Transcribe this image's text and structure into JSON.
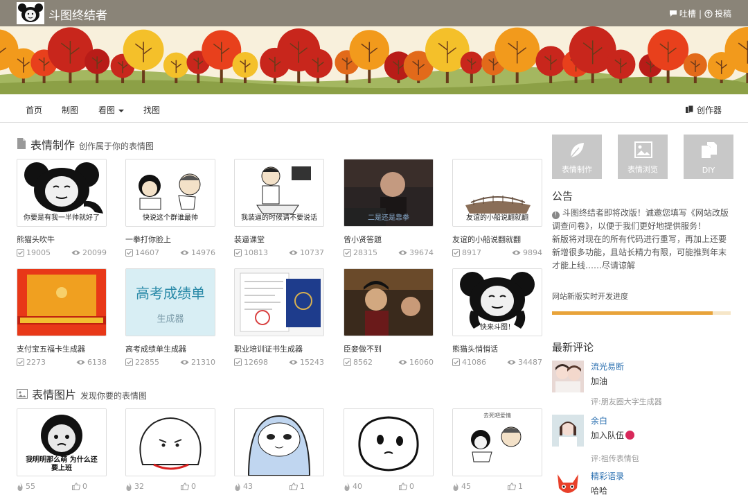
{
  "header": {
    "site_name": "斗图终结者",
    "link_feedback": "吐槽",
    "separator": "|",
    "link_submit": "投稿"
  },
  "nav": {
    "items": [
      "首页",
      "制图",
      "看图",
      "找图"
    ],
    "creator_label": "创作器"
  },
  "section_make": {
    "title": "表情制作",
    "subtitle": "创作属于你的表情图",
    "cards": [
      {
        "title": "熊猫头吹牛",
        "caption": "你要是有我一半帅就好了",
        "used": "19005",
        "views": "20099"
      },
      {
        "title": "一拳打你脸上",
        "caption": "快说这个群谁最帅",
        "used": "14607",
        "views": "14976"
      },
      {
        "title": "装逼课堂",
        "caption": "我装逼的时候请不要说话",
        "used": "10813",
        "views": "10737"
      },
      {
        "title": "曾小贤答题",
        "caption": "二是还是靠拳",
        "used": "28315",
        "views": "39674"
      },
      {
        "title": "友谊的小船说翻就翻",
        "caption": "友谊的小船说翻就翻",
        "used": "8917",
        "views": "9894"
      },
      {
        "title": "支付宝五福卡生成器",
        "caption": "",
        "used": "2273",
        "views": "6138"
      },
      {
        "title": "高考成绩单生成器",
        "caption": "高考成绩单",
        "caption2": "生成器",
        "used": "22855",
        "views": "21310"
      },
      {
        "title": "职业培训证书生成器",
        "caption": "",
        "used": "12698",
        "views": "15243"
      },
      {
        "title": "臣妾做不到",
        "caption": "",
        "used": "8562",
        "views": "16060"
      },
      {
        "title": "熊猫头悄悄话",
        "caption": "快来斗图！",
        "used": "41086",
        "views": "34487"
      }
    ]
  },
  "section_images": {
    "title": "表情图片",
    "subtitle": "发现你要的表情图",
    "cards": [
      {
        "caption": "我明明那么萌 为什么还要上班",
        "likes": "55",
        "thumbs": "0"
      },
      {
        "caption": "",
        "likes": "32",
        "thumbs": "0"
      },
      {
        "caption": "",
        "likes": "43",
        "thumbs": "1"
      },
      {
        "caption": "",
        "likes": "40",
        "thumbs": "0"
      },
      {
        "caption": "去死吧爱情",
        "likes": "45",
        "thumbs": "1"
      }
    ]
  },
  "sidebar": {
    "buttons": [
      "表情制作",
      "表情浏览",
      "DIY"
    ],
    "notice_title": "公告",
    "notice_p1": "斗图终结者即将改版！诚邀您填写《网站改版调查问卷》，以便于我们更好地提供服务！",
    "notice_p2": "新版将对现在的所有代码进行重写，再加上还要新增很多功能，且站长精力有限，可能推到年末才能上线……尽请谅解",
    "progress_label": "网站新版实时开发进度",
    "progress": 0.9,
    "comments_title": "最新评论",
    "comments": [
      {
        "name": "流光易断",
        "text": "加油",
        "meta": "评:朋友圈大字生成器"
      },
      {
        "name": "余白",
        "text": "加入队伍",
        "meta": "评:祖传表情包"
      },
      {
        "name": "精彩语录",
        "text": "哈哈",
        "meta": ""
      }
    ]
  },
  "colors": {
    "topbar": "#8a8478",
    "accent": "#e8a33a",
    "link": "#2a6fb0"
  }
}
